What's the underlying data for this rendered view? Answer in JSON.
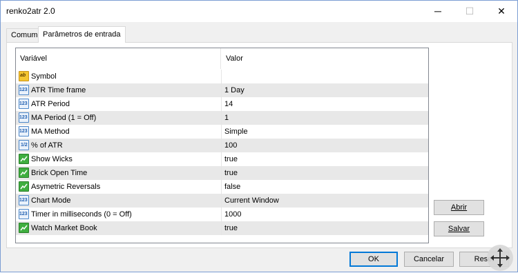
{
  "window": {
    "title": "renko2atr 2.0",
    "minimize_glyph": "─",
    "maximize_glyph": "☐",
    "close_glyph": "✕"
  },
  "tabs": [
    {
      "label": "Comum"
    },
    {
      "label": "Parâmetros de entrada"
    }
  ],
  "grid": {
    "col_variable": "Variável",
    "col_value": "Valor",
    "rows": [
      {
        "icon": "string-type-icon",
        "name": "Symbol",
        "value": ""
      },
      {
        "icon": "integer-type-icon",
        "name": "ATR Time frame",
        "value": "1 Day"
      },
      {
        "icon": "integer-type-icon",
        "name": "ATR Period",
        "value": "14"
      },
      {
        "icon": "integer-type-icon",
        "name": "MA Period (1 = Off)",
        "value": "1"
      },
      {
        "icon": "integer-type-icon",
        "name": "MA Method",
        "value": "Simple"
      },
      {
        "icon": "double-type-icon",
        "name": "% of ATR",
        "value": "100"
      },
      {
        "icon": "bool-type-icon",
        "name": "Show Wicks",
        "value": "true"
      },
      {
        "icon": "bool-type-icon",
        "name": "Brick Open Time",
        "value": "true"
      },
      {
        "icon": "bool-type-icon",
        "name": "Asymetric Reversals",
        "value": "false"
      },
      {
        "icon": "integer-type-icon",
        "name": "Chart Mode",
        "value": "Current Window"
      },
      {
        "icon": "integer-type-icon",
        "name": "Timer in milliseconds (0 = Off)",
        "value": "1000"
      },
      {
        "icon": "bool-type-icon",
        "name": "Watch Market Book",
        "value": "true"
      }
    ],
    "icon_text": {
      "string": "ab",
      "integer": "123",
      "double": "1/2"
    }
  },
  "buttons": {
    "abrir": "Abrir",
    "salvar": "Salvar",
    "ok": "OK",
    "cancel": "Cancelar",
    "reset": "Reset"
  },
  "colors": {
    "accent": "#0078d7",
    "row_alt": "#e8e8e8"
  }
}
